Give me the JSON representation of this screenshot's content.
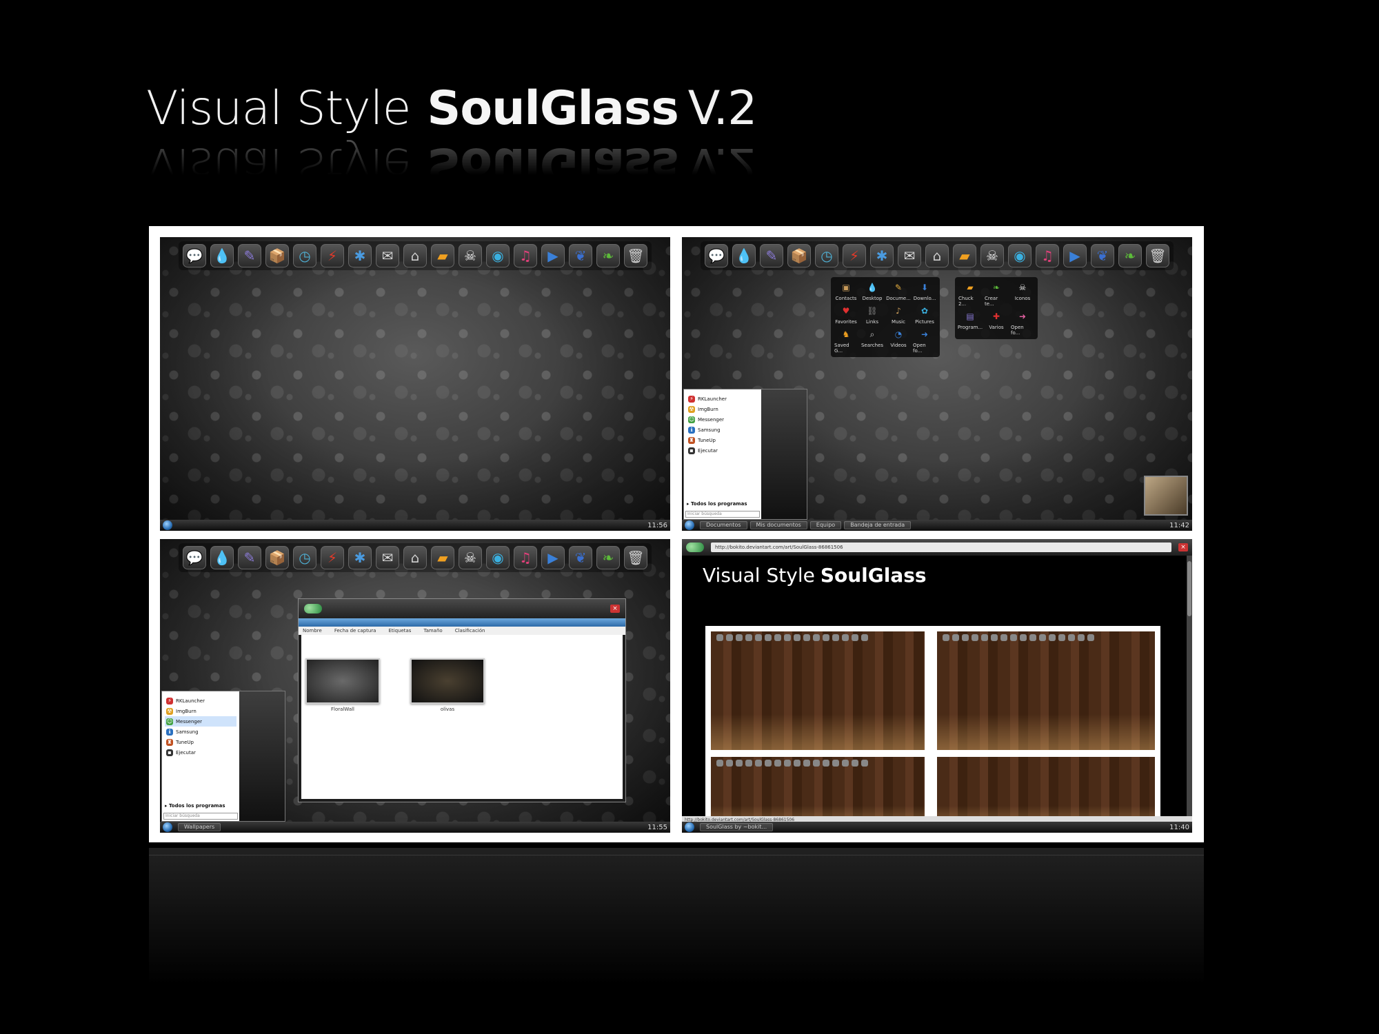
{
  "title": {
    "light": "Visual Style",
    "bold": "SoulGlass",
    "version": "V.2"
  },
  "dock_icons": [
    {
      "icon": "speech-bubble-icon",
      "glyph": "💬",
      "color": "#e0609a"
    },
    {
      "icon": "droplet-icon",
      "glyph": "💧",
      "color": "#e8337a"
    },
    {
      "icon": "pen-icon",
      "glyph": "✎",
      "color": "#8b7bd8"
    },
    {
      "icon": "box-icon",
      "glyph": "📦",
      "color": "#c89b5a"
    },
    {
      "icon": "clock-icon",
      "glyph": "◷",
      "color": "#4fb3d8"
    },
    {
      "icon": "lightning-icon",
      "glyph": "⚡",
      "color": "#e23a2a"
    },
    {
      "icon": "puzzle-icon",
      "glyph": "✱",
      "color": "#4a9be0"
    },
    {
      "icon": "mail-icon",
      "glyph": "✉",
      "color": "#d8d8d8"
    },
    {
      "icon": "home-icon",
      "glyph": "⌂",
      "color": "#cfcfcf"
    },
    {
      "icon": "folder-icon",
      "glyph": "▰",
      "color": "#f0a020"
    },
    {
      "icon": "skull-icon",
      "glyph": "☠",
      "color": "#eeeeee"
    },
    {
      "icon": "eye-icon",
      "glyph": "◉",
      "color": "#3ab0e0"
    },
    {
      "icon": "music-icon",
      "glyph": "♫",
      "color": "#e0407a"
    },
    {
      "icon": "video-icon",
      "glyph": "▶",
      "color": "#3a80d8"
    },
    {
      "icon": "feather-icon",
      "glyph": "❦",
      "color": "#3a6fd0"
    },
    {
      "icon": "leaf-icon",
      "glyph": "❧",
      "color": "#5dbb3a"
    },
    {
      "icon": "trash-icon",
      "glyph": "🗑",
      "color": "#cccccc"
    }
  ],
  "clocks": {
    "s1": "11:56",
    "s2": "11:42",
    "s3": "11:55",
    "s4": "11:40"
  },
  "taskbar2": [
    "Documentos",
    "Mis documentos",
    "Equipo",
    "Bandeja de entrada"
  ],
  "taskbar3": [
    "Wallpapers"
  ],
  "taskbar4": [
    "SoulGlass by ~bokit..."
  ],
  "start_menu": {
    "items": [
      {
        "label": "RKLauncher",
        "color": "#d03030",
        "glyph": "⚡"
      },
      {
        "label": "ImgBurn",
        "color": "#e0a020",
        "glyph": "☢"
      },
      {
        "label": "Messenger",
        "color": "#40a040",
        "glyph": "☺"
      },
      {
        "label": "Samsung",
        "color": "#2a70c0",
        "glyph": "ℹ"
      },
      {
        "label": "TuneUp",
        "color": "#c05020",
        "glyph": "♜"
      },
      {
        "label": "Ejecutar",
        "color": "#333333",
        "glyph": "▪"
      }
    ],
    "all_programs": "Todos los programas",
    "search_placeholder": "Iniciar búsqueda"
  },
  "stack1": [
    {
      "label": "Contacts",
      "glyph": "▣",
      "color": "#c89b5a"
    },
    {
      "label": "Desktop",
      "glyph": "💧",
      "color": "#3ab0e0"
    },
    {
      "label": "Docume...",
      "glyph": "✎",
      "color": "#e8b040"
    },
    {
      "label": "Downlo...",
      "glyph": "⬇",
      "color": "#3a80d8"
    },
    {
      "label": "Favorites",
      "glyph": "♥",
      "color": "#e03030"
    },
    {
      "label": "Links",
      "glyph": "⛓",
      "color": "#888888"
    },
    {
      "label": "Music",
      "glyph": "♪",
      "color": "#c89b5a"
    },
    {
      "label": "Pictures",
      "glyph": "✿",
      "color": "#3ab0e0"
    },
    {
      "label": "Saved G...",
      "glyph": "♞",
      "color": "#f0a020"
    },
    {
      "label": "Searches",
      "glyph": "⌕",
      "color": "#cccccc"
    },
    {
      "label": "Videos",
      "glyph": "◔",
      "color": "#3a80d8"
    },
    {
      "label": "Open fo...",
      "glyph": "➜",
      "color": "#3a80d8"
    }
  ],
  "stack2": [
    {
      "label": "Chuck 2...",
      "glyph": "▰",
      "color": "#f0a020"
    },
    {
      "label": "Crear te...",
      "glyph": "❧",
      "color": "#5dbb3a"
    },
    {
      "label": "Iconos",
      "glyph": "☠",
      "color": "#eeeeee"
    },
    {
      "label": "Program...",
      "glyph": "▤",
      "color": "#8b7bd8"
    },
    {
      "label": "Varios",
      "glyph": "✚",
      "color": "#e03030"
    },
    {
      "label": "Open fo...",
      "glyph": "➜",
      "color": "#e060a0"
    }
  ],
  "explorer": {
    "columns": [
      "Nombre",
      "Fecha de captura",
      "Etiquetas",
      "Tamaño",
      "Clasificación"
    ],
    "files": [
      {
        "label": "FloralWall"
      },
      {
        "label": "olivas"
      }
    ]
  },
  "browser": {
    "url": "http://bokito.deviantart.com/art/SoulGlass-86861506",
    "page_title_light": "Visual Style",
    "page_title_bold": "SoulGlass",
    "status": "http://bokito.deviantart.com/art/SoulGlass-86861506"
  }
}
